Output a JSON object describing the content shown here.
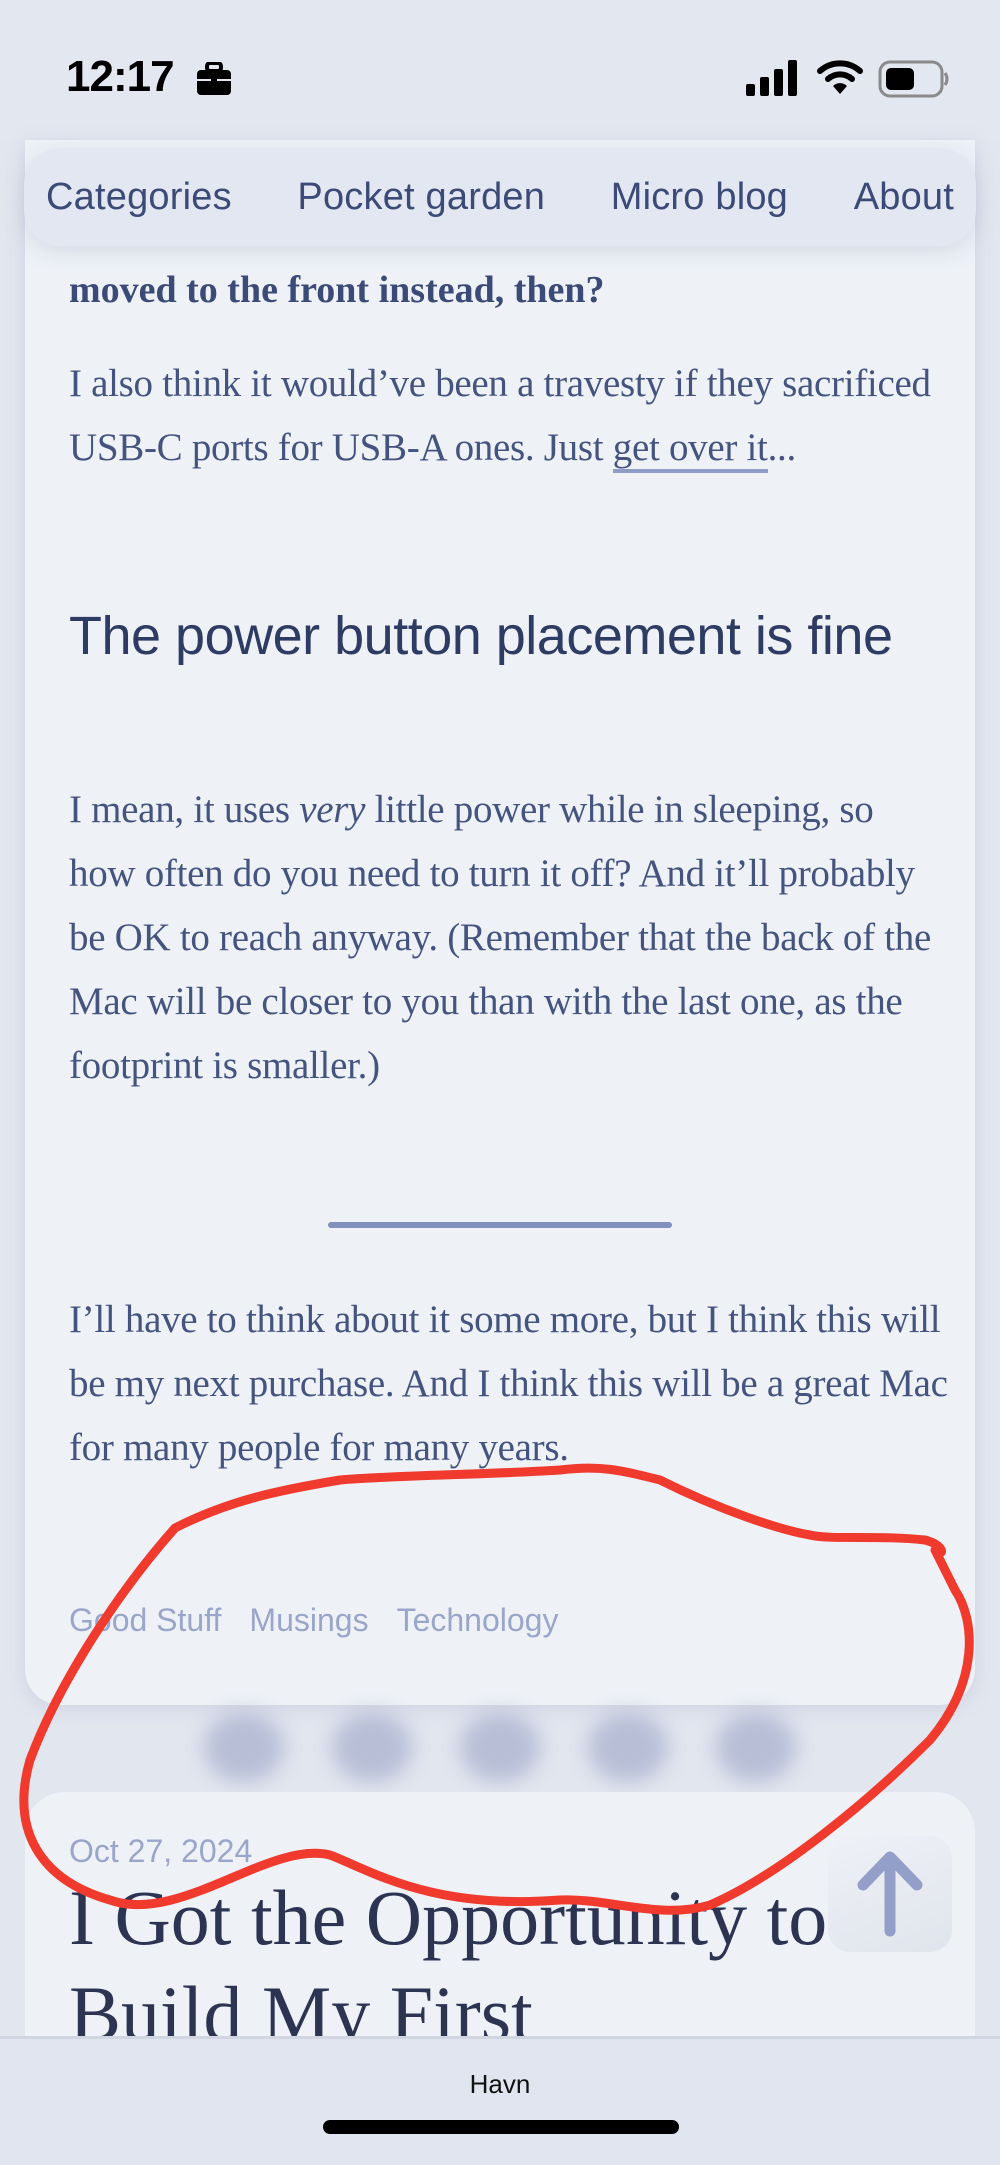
{
  "status_bar": {
    "time": "12:17",
    "icons": [
      "briefcase-icon",
      "cellular-signal-icon",
      "wifi-icon",
      "battery-icon"
    ]
  },
  "nav": {
    "items": [
      {
        "label": "Categories"
      },
      {
        "label": "Pocket garden"
      },
      {
        "label": "Micro blog"
      },
      {
        "label": "About"
      }
    ]
  },
  "article": {
    "partial_question": "moved to the front instead, then?",
    "paragraph1_before_link": "I also think it would’ve been a travesty if they sacrificed USB-C ports for USB-A ones. Just ",
    "paragraph1_link": "get over it",
    "paragraph1_after_link": "...",
    "heading": "The power button placement is fine",
    "paragraph2_before_em": "I mean, it uses ",
    "paragraph2_em": "very",
    "paragraph2_after_em": " little power while in sleeping, so how often do you need to turn it off? And it’ll probably be OK to reach anyway. (Remember that the back of the Mac will be closer to you than with the last one, as the footprint is smaller.)",
    "paragraph3": "I’ll have to think about it some more, but I think this will be my next purchase. And I think this will be a great Mac for many people for many years.",
    "tags": [
      "Good Stuff",
      "Musings",
      "Technology"
    ]
  },
  "next_post": {
    "date": "Oct 27, 2024",
    "title": "I Got the Opportunity to Build My First"
  },
  "scroll_to_top": {
    "icon": "arrow-up-icon"
  },
  "browser_bar": {
    "site_label": "Havn"
  },
  "colors": {
    "background": "#e2e6ef",
    "card": "#eef2f7",
    "text": "#45547f",
    "accent": "#8190bd",
    "tag": "#9aa6c9",
    "annotation": "#f03a2e"
  }
}
